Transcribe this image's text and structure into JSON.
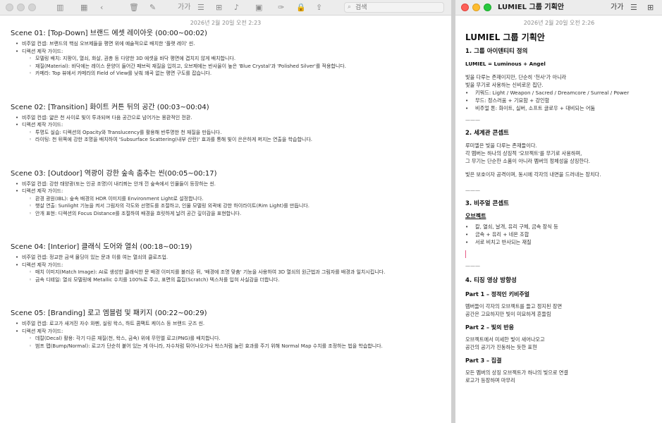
{
  "left_window": {
    "toolbar": {
      "format_label": "가가",
      "search_placeholder": "검색"
    },
    "date": "2026년 2월 20일 오전 2:23",
    "scenes": [
      {
        "title": "Scene 01: [Top-Down] 브랜드 에셋 레이아웃 (00:00~00:02)",
        "lines": [
          {
            "level": 1,
            "text": "비주얼 컨셉: 브랜드의 핵심 오브제들을 평면 위에 예술적으로 배치한 '플랫 레이' 씬."
          },
          {
            "level": 1,
            "text": "디렉션 제작 가이드:"
          },
          {
            "level": 2,
            "text": "모델링 배치: 지팡이, 열쇠, 화살, 권총 등 다양한 3D 에셋을 바닥 평면에 겹치지 않게 배치합니다."
          },
          {
            "level": 2,
            "text": "재질(Material): 바닥에는 레이스 문양이 들어간 패브릭 재질을 입히고, 오브제에는 반사율이 높은 'Blue Crystal'과 'Polished Silver'를 적용합니다."
          },
          {
            "level": 2,
            "text": "카메라: Top 뷰에서 카메라의 Field of View를 낮춰 왜곡 없는 평면 구도를 잡습니다."
          }
        ]
      },
      {
        "title": "Scene 02: [Transition] 화이트 커튼 뒤의 공간 (00:03~00:04)",
        "lines": [
          {
            "level": 1,
            "text": "비주얼 컨셉: 얇은 천 사이로 빛이 투과되며 다음 공간으로 넘어가는 몽환적인 전환."
          },
          {
            "level": 1,
            "text": "디렉션 제작 가이드:"
          },
          {
            "level": 2,
            "text": "투명도 실습: 디렉션의 Opacity와 Translucency를 활용해 반투명한 천 재질을 만듭니다."
          },
          {
            "level": 2,
            "text": "라이팅: 천 뒤쪽에 강한 조명을 배치하여 'Subsurface Scattering(내부 산란)' 효과를 통해 빛이 은은하게 퍼지는 연출을 학습합니다."
          }
        ]
      },
      {
        "title": "Scene 03: [Outdoor] 역광이 강한 숲속 춤추는 씬(00:05~00:17)",
        "lines": [
          {
            "level": 1,
            "text": "비주얼 컨셉: 강한 태양광(또는 인공 조명)이 내리쬐는 안개 낀 숲속에서 인물들이 등장하는 씬."
          },
          {
            "level": 1,
            "text": "디렉션 제작 가이드:"
          },
          {
            "level": 2,
            "text": "환경 광원(IBL): 숲속 배경의 HDR 이미지를 Environment Light로 설정합니다."
          },
          {
            "level": 2,
            "text": "햇살 연출: Sunlight 기능을 켜서 그림자의 각도와 선명도를 조절하고, 인물 모델링 외곽에 강한 하이라이트(Rim Light)를 만듭니다."
          },
          {
            "level": 2,
            "text": "안개 표현: 디렉션의 Focus Distance를 조절하여 배경을 흐릿하게 날려 공간 깊이감을 표현합니다."
          }
        ]
      },
      {
        "title": "Scene 04: [Interior] 클래식 도어와 열쇠 (00:18~00:19)",
        "lines": [
          {
            "level": 1,
            "text": "비주얼 컨셉: 정교한 금색 몰딩이 있는 문과 이를 여는 열쇠의 클로즈업."
          },
          {
            "level": 1,
            "text": "디렉션 제작 가이드:"
          },
          {
            "level": 2,
            "text": "매치 이미지(Match Image): AI로 생성한 클래식한 문 배경 이미지를 불러온 뒤, '배경에 조명 맞춤' 기능을 사용하여 3D 열쇠의 원근법과 그림자를 배경과 일치시킵니다."
          },
          {
            "level": 2,
            "text": "금속 디테일: 열쇠 모델링에 Metallic 수치를 100%로 주고, 표면의 흠집(Scratch) 텍스처를 입혀 사실감을 더합니다."
          }
        ]
      },
      {
        "title": "Scene 05: [Branding] 로고 엠블럼 및 패키지 (00:22~00:29)",
        "lines": [
          {
            "level": 1,
            "text": "비주얼 컨셉: 로고가 새겨진 자수 와펜, 실링 왁스, 하트 콤팩트 케이스 등 브랜드 굿즈 씬."
          },
          {
            "level": 1,
            "text": "디렉션 제작 가이드:"
          },
          {
            "level": 2,
            "text": "데칼(Decal) 활용: 각기 다른 재질(천, 왁스, 금속) 위에 무민엘 로고(PNG)를 배치합니다."
          },
          {
            "level": 2,
            "text": "범프 맵(Bump/Normal): 로고가 단순히 붙어 있는 게 아니라, 자수처럼 튀어나오거나 왁스처럼 눌린 효과를 주기 위해 Normal Map 수치를 조정하는 법을 학습합니다."
          }
        ]
      }
    ]
  },
  "right_window": {
    "window_title": "LUMIEL 그룹 기획안",
    "toolbar": {
      "format_label": "가가"
    },
    "date": "2026년 2월 20일 오전 2:26",
    "doc_title": "LUMIEL 그룹 기획안",
    "rule": "———",
    "sec1": {
      "heading": "1. 그룹 아이덴티티 정의",
      "formula": "LUMIEL = Luminous + Angel",
      "para": [
        "빛을 다루는 존재이지만, 단순히 '천사'가 아니라",
        "빛을 무기로 사용하는 신비로운 집단."
      ],
      "bullets": [
        "키워드: Light / Weapon / Sacred / Dreamcore / Surreal / Power",
        "무드: 정스러움 + 기묘함 + 강인함",
        "비주얼 톤: 화이트, 실버, 소프트 글로우 + 대비되는 어둠"
      ]
    },
    "sec2": {
      "heading": "2. 세계관 콘셉트",
      "para1": [
        "루미엘은 빛을 다루는 존재들이다.",
        "각 멤버는 하나의 상징적 '오브젝트'를 무기로 사용하며,",
        "그 무기는 단순한 소품이 아니라 멤버의 정체성을 상징한다."
      ],
      "para2": "빛은 보호이자 공격이며, 동시에 각자의 내면을 드러내는 장치다."
    },
    "sec3": {
      "heading": "3. 비주얼 콘셉트",
      "sub": "오브젝트",
      "bullets": [
        "칼, 열쇠, 날개, 유리 구체, 금속 장식 등",
        "금속 + 유리 + 네온 조합",
        "서로 비치고 반사되는 재질"
      ]
    },
    "sec4": {
      "heading": "4. 티징 영상 방향성",
      "parts": [
        {
          "title": "Part 1 – 정적인 키비주얼",
          "lines": [
            "멤버들이 각자의 오브젝트를 들고 정지된 장면",
            "공간은 고요하지만 빛이 미묘하게 흔들림"
          ]
        },
        {
          "title": "Part 2 – 빛의 반응",
          "lines": [
            "오브젝트에서 미세한 빛이 새어나오고",
            "공간의 공기가 진동하는 듯한 표현"
          ]
        },
        {
          "title": "Part 3 – 집결",
          "lines": [
            "모든 멤버의 상징 오브젝트가 하나의 빛으로 연결",
            "로고가 등장하며 마무리"
          ]
        }
      ]
    }
  }
}
